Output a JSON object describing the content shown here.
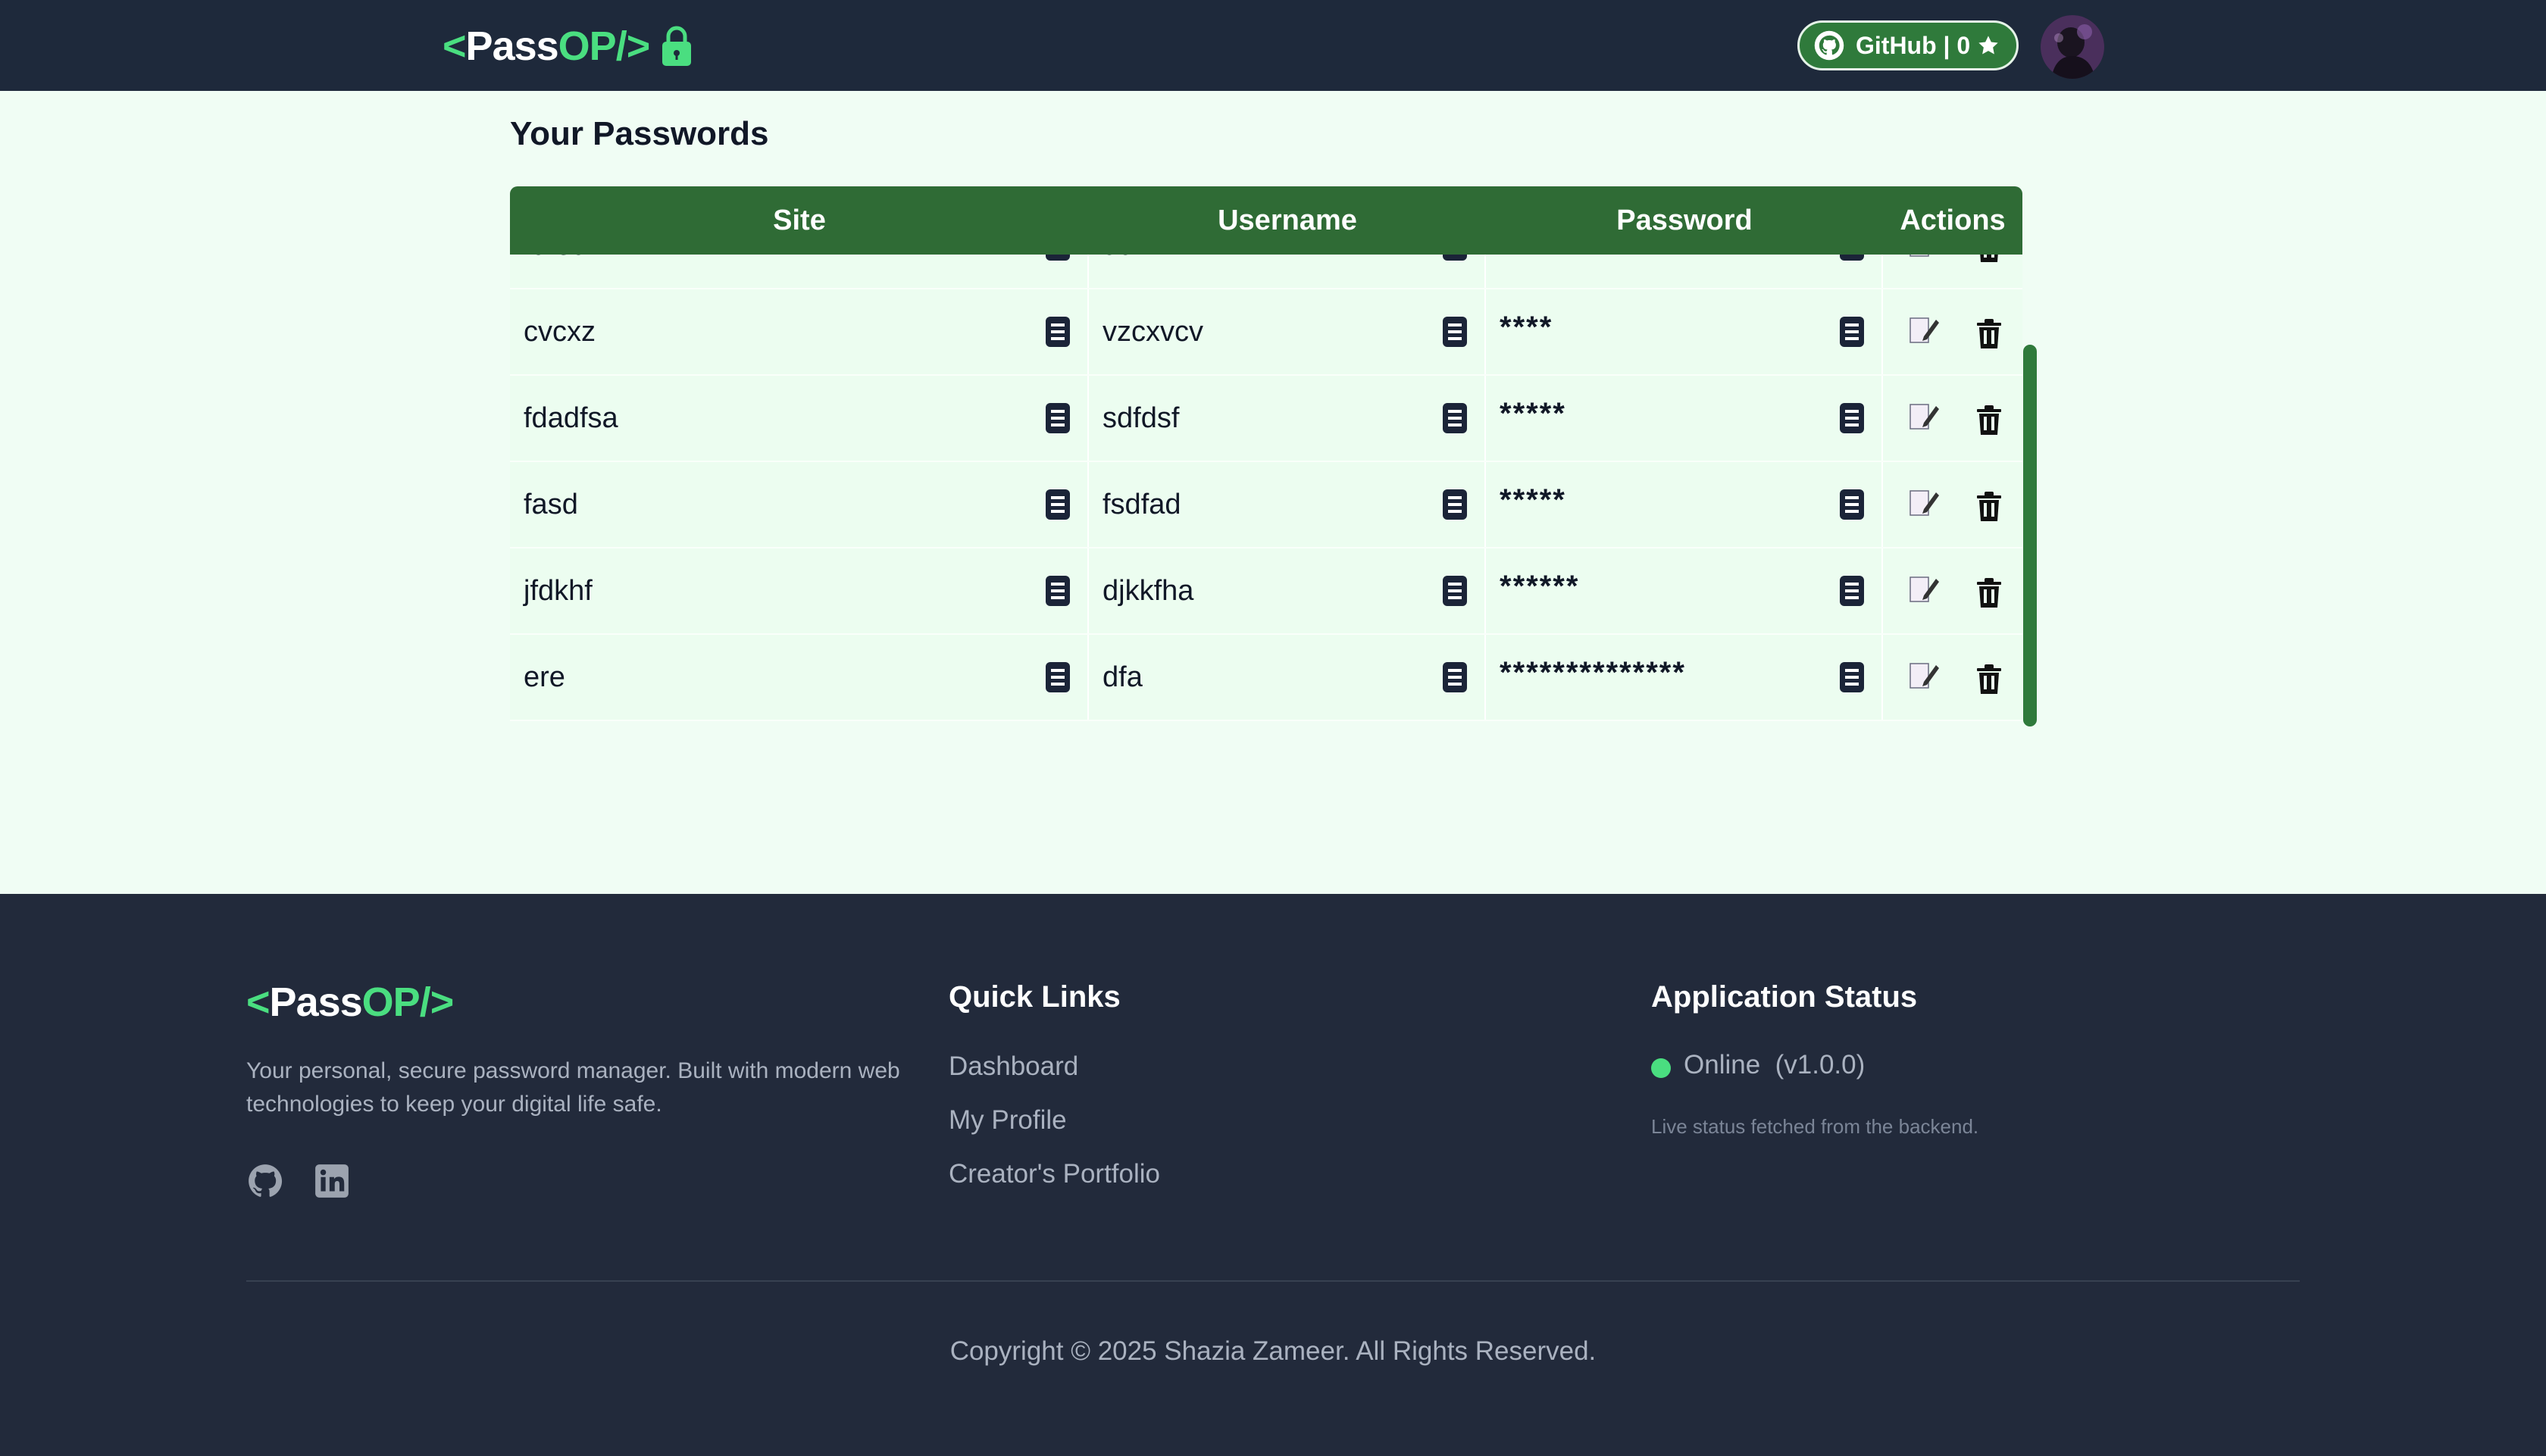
{
  "navbar": {
    "logo": {
      "lt": "<",
      "pass": "Pass",
      "op": "OP/",
      "gt": " >"
    },
    "github_button": "GitHub | 0"
  },
  "main": {
    "title": "Your Passwords",
    "columns": [
      "Site",
      "Username",
      "Password",
      "Actions"
    ],
    "partial_row": {
      "site": "fdfed",
      "username": "dd"
    },
    "rows": [
      {
        "site": "cvcxz",
        "username": "vzcxvcv",
        "password": "****"
      },
      {
        "site": "fdadfsa",
        "username": "sdfdsf",
        "password": "*****"
      },
      {
        "site": "fasd",
        "username": "fsdfad",
        "password": "*****"
      },
      {
        "site": "jfdkhf",
        "username": "djkkfha",
        "password": "******"
      },
      {
        "site": "ere",
        "username": "dfa",
        "password": "**************"
      }
    ]
  },
  "footer": {
    "logo": {
      "lt": "<",
      "pass": "Pass",
      "op": "OP/",
      "gt": ">"
    },
    "description": "Your personal, secure password manager. Built with modern web technologies to keep your digital life safe.",
    "quick_links_heading": "Quick Links",
    "quick_links": [
      "Dashboard",
      "My Profile",
      "Creator's Portfolio"
    ],
    "status_heading": "Application Status",
    "status": "Online  (v1.0.0)",
    "status_note": "Live status fetched from the backend.",
    "copyright": "Copyright © 2025 Shazia Zameer. All Rights Reserved."
  },
  "colors": {
    "accent_green": "#4ade80",
    "header_dark": "#1e293b",
    "table_header": "#2f6b35",
    "row_bg": "#ecfdf0",
    "page_bg": "#f0fdf4"
  },
  "icons": [
    "lock-icon",
    "github-icon",
    "star-icon",
    "copy-icon",
    "edit-icon",
    "trash-icon",
    "linkedin-icon"
  ]
}
